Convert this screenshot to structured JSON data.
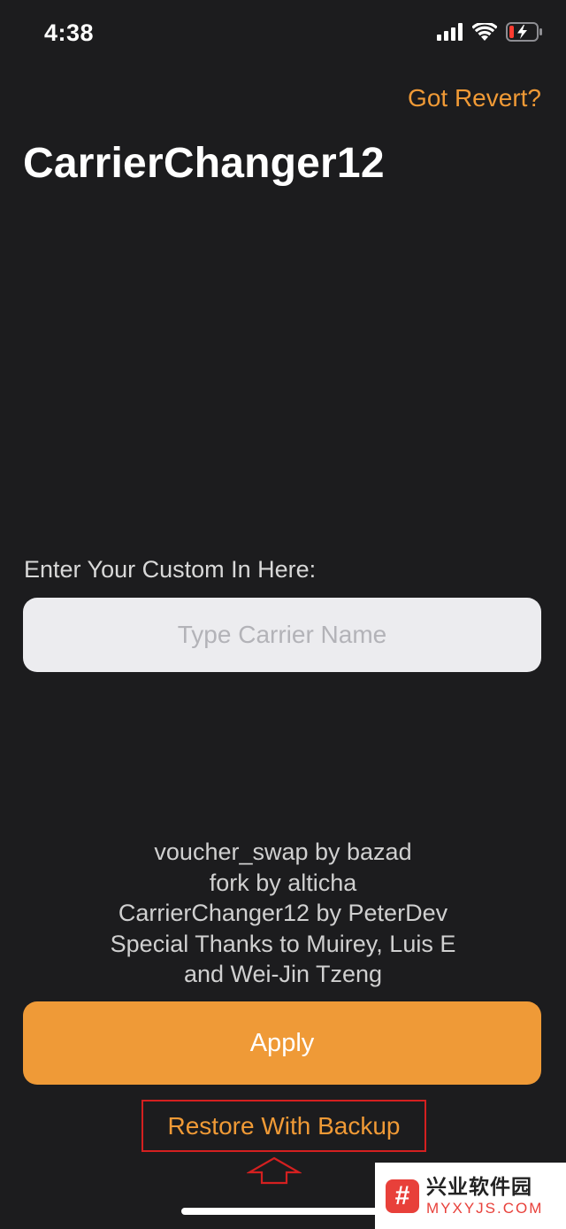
{
  "status_bar": {
    "time": "4:38",
    "icons": [
      "cellular-signal-icon",
      "wifi-icon",
      "battery-charging-icon"
    ]
  },
  "header": {
    "revert_link": "Got Revert?",
    "title": "CarrierChanger12"
  },
  "form": {
    "label": "Enter Your Custom In Here:",
    "input_placeholder": "Type Carrier Name",
    "input_value": ""
  },
  "credits": [
    "voucher_swap by bazad",
    "fork by alticha",
    "CarrierChanger12 by PeterDev",
    "Special Thanks to Muirey, Luis E",
    "and Wei-Jin Tzeng"
  ],
  "actions": {
    "apply_label": "Apply",
    "restore_label": "Restore With Backup"
  },
  "watermark": {
    "logo_glyph": "#",
    "name_cn": "兴业软件园",
    "site": "MYXYJS.COM"
  },
  "colors": {
    "background": "#1c1c1e",
    "accent": "#ef9a37",
    "annotation": "#d42020",
    "input_bg": "#ececef"
  }
}
